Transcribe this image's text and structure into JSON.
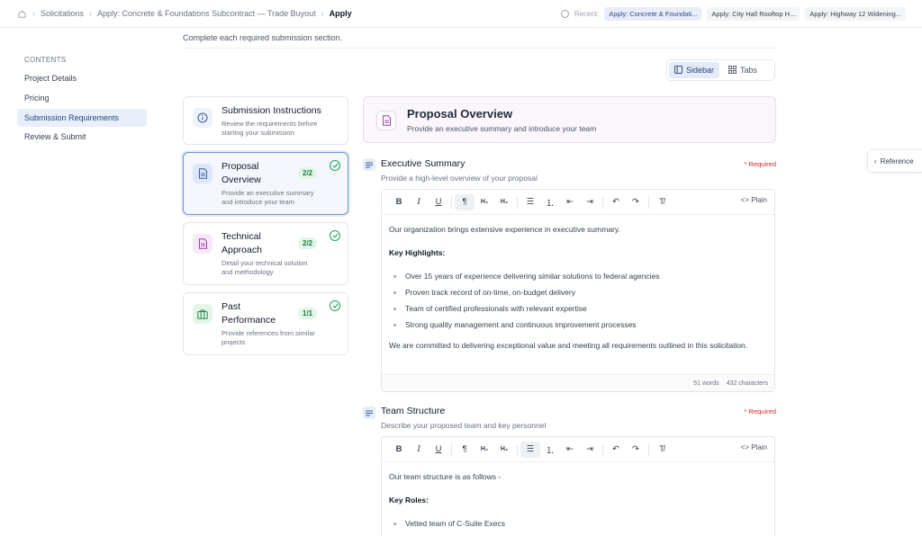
{
  "breadcrumb": {
    "items": [
      "Solicitations",
      "Apply: Concrete & Foundations Subcontract — Trade Buyout",
      "Apply"
    ]
  },
  "recent": {
    "label": "Recent:",
    "items": [
      "Apply: Concrete & Foundati...",
      "Apply: City Hall Rooftop H...",
      "Apply: Highway 12 Widening..."
    ]
  },
  "contents": {
    "label": "CONTENTS",
    "items": [
      "Project Details",
      "Pricing",
      "Submission Requirements",
      "Review & Submit"
    ]
  },
  "page": {
    "subtitle": "Complete each required submission section."
  },
  "view_toggle": {
    "sidebar": "Sidebar",
    "tabs": "Tabs"
  },
  "sections": [
    {
      "title": "Submission Instructions",
      "desc1": "Review the requirements before",
      "desc2": "starting your submission"
    },
    {
      "title1": "Proposal",
      "title2": "Overview",
      "desc1": "Provide an executive summary",
      "desc2": "and introduce your team",
      "badge": "2/2"
    },
    {
      "title1": "Technical",
      "title2": "Approach",
      "desc1": "Detail your technical solution",
      "desc2": "and methodology",
      "badge": "2/2"
    },
    {
      "title1": "Past",
      "title2": "Performance",
      "desc1": "Provide references from similar",
      "desc2": "projects",
      "badge": "1/1"
    }
  ],
  "header": {
    "title": "Proposal Overview",
    "subtitle": "Provide an executive summary and introduce your team"
  },
  "fields": {
    "exec": {
      "title": "Executive Summary",
      "subtitle": "Provide a high-level overview of your proposal",
      "required": "* Required",
      "plain": "<> Plain",
      "intro": "Our organization brings extensive experience in executive summary.",
      "highlights_label": "Key Highlights:",
      "bullets": [
        "Over 15 years of experience delivering similar solutions to federal agencies",
        "Proven track record of on-time, on-budget delivery",
        "Team of certified professionals with relevant expertise",
        "Strong quality management and continuous improvement processes"
      ],
      "closing": "We are committed to delivering exceptional value and meeting all requirements outlined in this solicitation.",
      "words": "51 words",
      "chars": "432 characters"
    },
    "team": {
      "title": "Team Structure",
      "subtitle": "Describe your proposed team and key personnel",
      "required": "* Required",
      "plain": "<> Plain",
      "intro": "Our team structure is as follows -",
      "roles_label": "Key Roles:",
      "bullets": [
        "Vetted team of C-Suite Execs"
      ]
    }
  },
  "toolbar": {
    "bold": "B",
    "italic": "I",
    "underline": "U",
    "paragraph": "¶",
    "h2": "H₂",
    "h3": "H₃",
    "bullet": "☰",
    "ordered": "⒈",
    "outdent": "⇤",
    "indent": "⇥",
    "undo": "↶",
    "redo": "↷",
    "clear": "T̸"
  },
  "reference": {
    "label": "Reference"
  },
  "colors": {
    "accent": "#2f4b8a",
    "success": "#22a35a",
    "required": "#dc2626"
  }
}
